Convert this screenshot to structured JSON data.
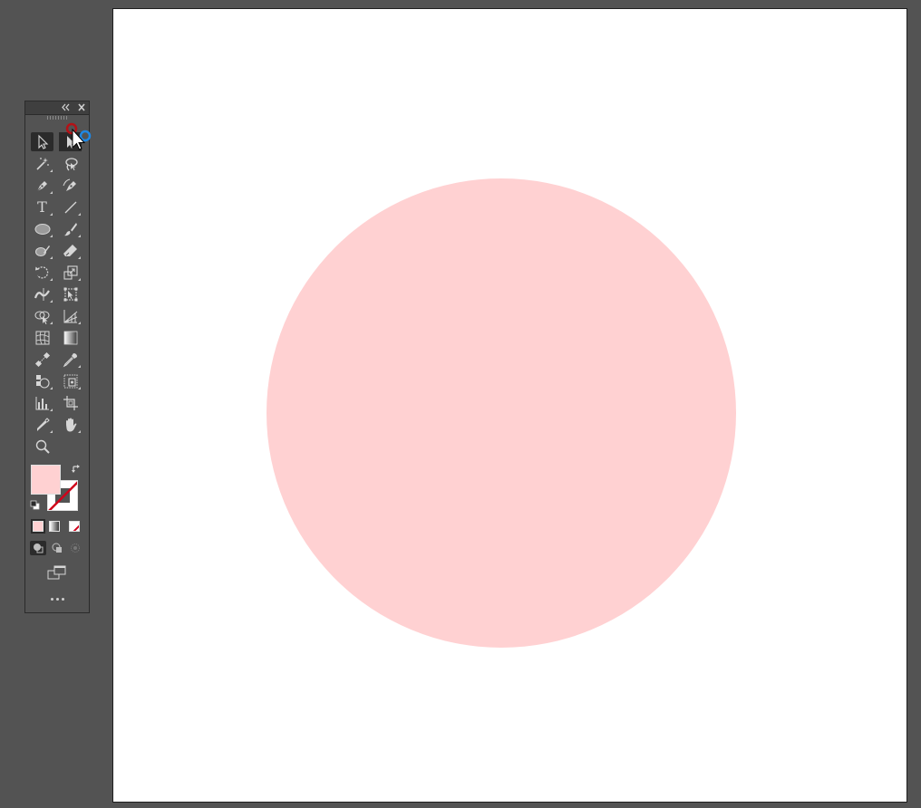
{
  "app": "vector-illustration-editor",
  "colors": {
    "pasteboard": "#535353",
    "artboard": "#ffffff",
    "circle_fill": "#ffd1d2",
    "fill_swatch": "#ffd1d2",
    "toolbar_bg": "#535353",
    "icon": "#d6d6d6",
    "none_slash": "#d0021b"
  },
  "toolbar": {
    "tools": [
      {
        "name": "selection-tool",
        "icon": "arrow-icon",
        "active": true
      },
      {
        "name": "direct-selection-tool",
        "icon": "hollow-arrow-icon",
        "active": false
      },
      {
        "name": "magic-wand-tool",
        "icon": "magic-wand-icon",
        "active": false
      },
      {
        "name": "lasso-tool",
        "icon": "lasso-icon",
        "active": false
      },
      {
        "name": "pen-tool",
        "icon": "pen-icon",
        "active": false
      },
      {
        "name": "curvature-tool",
        "icon": "curvature-pen-icon",
        "active": false
      },
      {
        "name": "type-tool",
        "icon": "type-icon",
        "label": "T",
        "active": false
      },
      {
        "name": "line-tool",
        "icon": "line-icon",
        "active": false
      },
      {
        "name": "ellipse-tool",
        "icon": "ellipse-icon",
        "active": false
      },
      {
        "name": "paintbrush-tool",
        "icon": "brush-icon",
        "active": false
      },
      {
        "name": "shaper-tool",
        "icon": "shaper-icon",
        "active": false
      },
      {
        "name": "eraser-tool",
        "icon": "eraser-icon",
        "active": false
      },
      {
        "name": "rotate-tool",
        "icon": "rotate-icon",
        "active": false
      },
      {
        "name": "scale-tool",
        "icon": "scale-icon",
        "active": false
      },
      {
        "name": "width-tool",
        "icon": "width-icon",
        "active": false
      },
      {
        "name": "free-transform-tool",
        "icon": "free-transform-icon",
        "active": false
      },
      {
        "name": "shape-builder-tool",
        "icon": "shape-builder-icon",
        "active": false
      },
      {
        "name": "perspective-grid-tool",
        "icon": "perspective-grid-icon",
        "active": false
      },
      {
        "name": "mesh-tool",
        "icon": "mesh-icon",
        "active": false
      },
      {
        "name": "gradient-tool",
        "icon": "gradient-icon",
        "active": false
      },
      {
        "name": "blend-tool",
        "icon": "blend-icon",
        "active": false
      },
      {
        "name": "eyedropper-tool",
        "icon": "eyedropper-icon",
        "active": false
      },
      {
        "name": "symbol-sprayer-tool",
        "icon": "symbol-sprayer-icon",
        "active": false
      },
      {
        "name": "slice-tool",
        "icon": "slice-icon",
        "active": false
      },
      {
        "name": "column-graph-tool",
        "icon": "column-graph-icon",
        "active": false
      },
      {
        "name": "artboard-tool",
        "icon": "artboard-icon",
        "active": false
      },
      {
        "name": "pencil-tool",
        "icon": "pencil-icon",
        "active": false
      },
      {
        "name": "hand-tool",
        "icon": "hand-icon",
        "active": false
      },
      {
        "name": "zoom-tool",
        "icon": "zoom-icon",
        "active": false
      }
    ]
  }
}
